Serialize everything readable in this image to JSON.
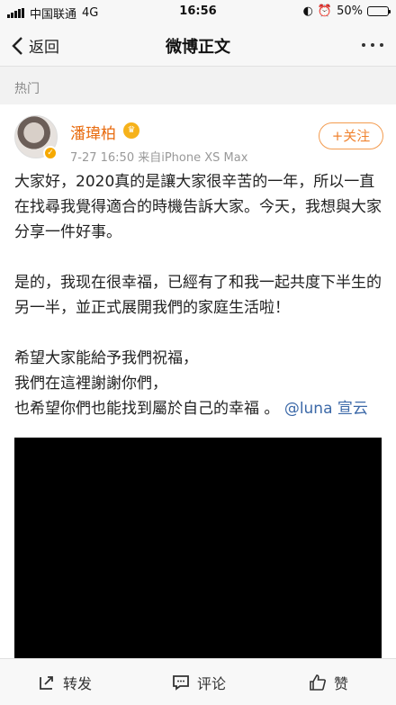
{
  "status_bar": {
    "carrier": "中国联通",
    "network": "4G",
    "time": "16:56",
    "battery": "50%",
    "battery_level": 0.5
  },
  "nav": {
    "back_label": "返回",
    "title": "微博正文"
  },
  "section": {
    "label": "热门"
  },
  "post": {
    "user_name": "潘瑋柏",
    "meta": "7-27 16:50  来自iPhone XS Max",
    "follow_label": "+关注",
    "paragraphs": [
      "大家好，2020真的是讓大家很辛苦的一年，所以一直在找尋我覺得適合的時機告訴大家。今天，我想與大家分享一件好事。",
      "是的，我现在很幸福，已經有了和我一起共度下半生的另一半，並正式展開我們的家庭生活啦！"
    ],
    "final_lines": [
      "希望大家能給予我們祝福，",
      "我們在這裡謝謝你們，",
      "也希望你們也能找到屬於自己的幸福 。"
    ],
    "mention": "@luna 宣云"
  },
  "actions": {
    "repost": "转发",
    "comment": "评论",
    "like": "赞"
  },
  "colors": {
    "accent": "#e86b0f",
    "mention": "#3c69a8"
  }
}
